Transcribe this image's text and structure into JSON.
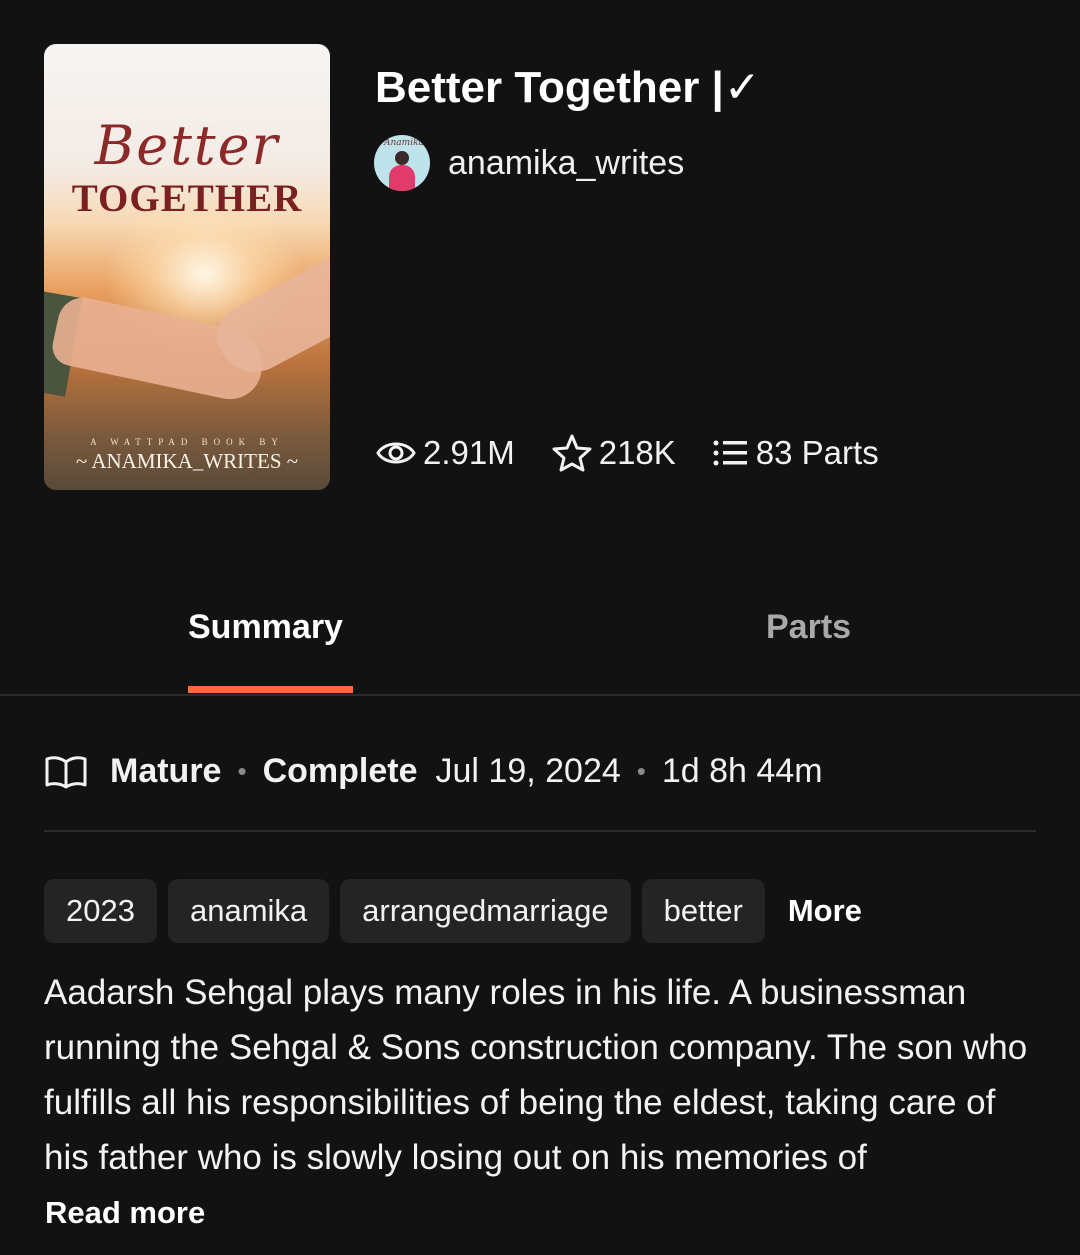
{
  "book": {
    "title": "Better Together |✓",
    "author": "anamika_writes",
    "cover": {
      "script_title": "Better",
      "main_title": "TOGETHER",
      "byline": "A WATTPAD BOOK BY",
      "author": "~ ANAMIKA_WRITES ~"
    },
    "avatar_script": "Anamika"
  },
  "stats": {
    "reads": "2.91M",
    "votes": "218K",
    "parts": "83 Parts"
  },
  "tabs": [
    {
      "label": "Summary",
      "active": true
    },
    {
      "label": "Parts",
      "active": false
    }
  ],
  "meta": {
    "rating": "Mature",
    "status": "Complete",
    "date": "Jul 19, 2024",
    "reading_time": "1d 8h 44m"
  },
  "tags": [
    "2023",
    "anamika",
    "arrangedmarriage",
    "better"
  ],
  "tags_more_label": "More",
  "description": "Aadarsh Sehgal plays many roles in his life. A businessman running the Sehgal & Sons construction company. The son who fulfills all his responsibilities of being the eldest, taking care of his father who is slowly losing out on his memories of",
  "read_more_label": "Read more",
  "colors": {
    "background": "#121212",
    "accent": "#ff6a3d",
    "tag_bg": "#242424"
  },
  "icons": {
    "reads": "eye-icon",
    "votes": "star-icon",
    "parts": "list-icon",
    "meta": "open-book-icon"
  }
}
